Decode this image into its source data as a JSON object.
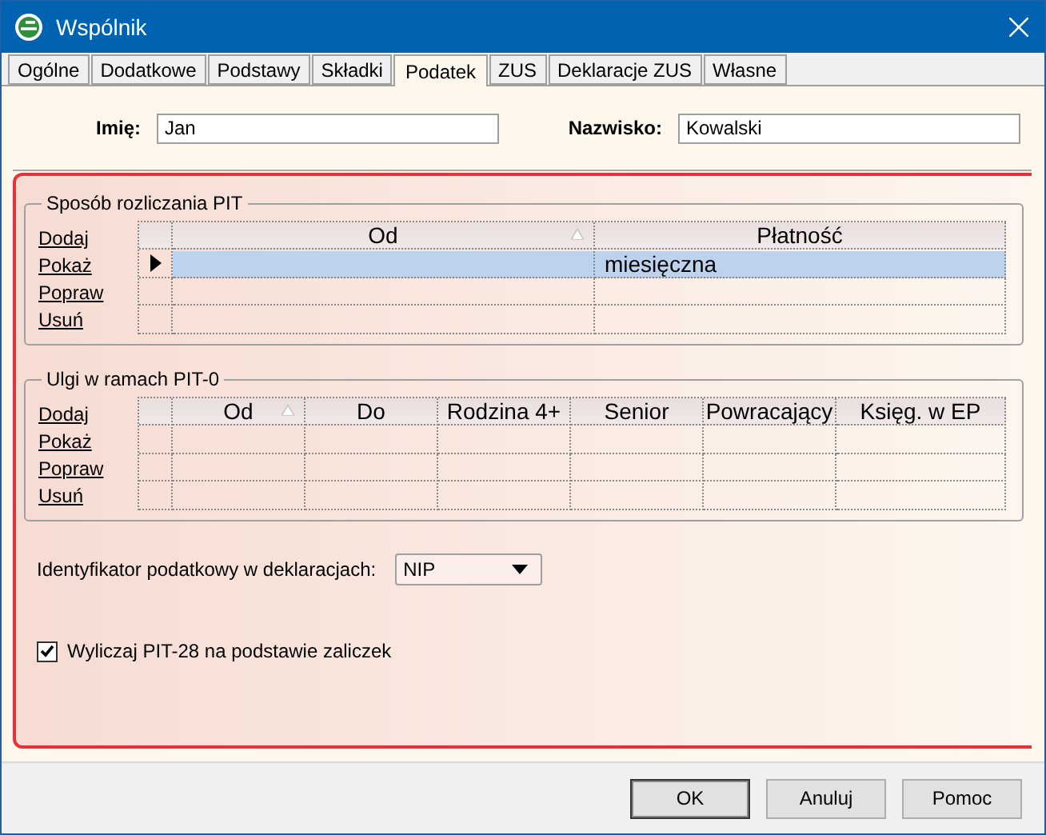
{
  "window": {
    "title": "Wspólnik"
  },
  "tabs": [
    {
      "label": "Ogólne",
      "selected": false
    },
    {
      "label": "Dodatkowe",
      "selected": false
    },
    {
      "label": "Podstawy",
      "selected": false
    },
    {
      "label": "Składki",
      "selected": false
    },
    {
      "label": "Podatek",
      "selected": true
    },
    {
      "label": "ZUS",
      "selected": false
    },
    {
      "label": "Deklaracje ZUS",
      "selected": false
    },
    {
      "label": "Własne",
      "selected": false
    }
  ],
  "person": {
    "first_name_label": "Imię:",
    "first_name": "Jan",
    "last_name_label": "Nazwisko:",
    "last_name": "Kowalski"
  },
  "groups": [
    {
      "title": "Sposób rozliczania PIT",
      "actions": [
        "Dodaj",
        "Pokaż",
        "Popraw",
        "Usuń"
      ],
      "columns": [
        {
          "label": "Od",
          "sorted": true
        },
        {
          "label": "Płatność",
          "sorted": false
        }
      ],
      "rows": [
        {
          "selected": true,
          "cells": [
            null,
            "miesięczna"
          ]
        },
        {
          "selected": false,
          "cells": [
            null,
            null
          ]
        },
        {
          "selected": false,
          "cells": [
            null,
            null
          ]
        }
      ]
    },
    {
      "title": "Ulgi w ramach PIT-0",
      "actions": [
        "Dodaj",
        "Pokaż",
        "Popraw",
        "Usuń"
      ],
      "columns": [
        {
          "label": "Od",
          "sorted": true
        },
        {
          "label": "Do",
          "sorted": false
        },
        {
          "label": "Rodzina 4+",
          "sorted": false
        },
        {
          "label": "Senior",
          "sorted": false
        },
        {
          "label": "Powracający",
          "sorted": false
        },
        {
          "label": "Księg. w EP",
          "sorted": false
        }
      ],
      "rows": [
        {
          "selected": false,
          "cells": [
            null,
            null,
            null,
            null,
            null,
            null
          ]
        },
        {
          "selected": false,
          "cells": [
            null,
            null,
            null,
            null,
            null,
            null
          ]
        },
        {
          "selected": false,
          "cells": [
            null,
            null,
            null,
            null,
            null,
            null
          ]
        }
      ]
    }
  ],
  "tax_id": {
    "label": "Identyfikator podatkowy w deklaracjach:",
    "value": "NIP"
  },
  "calc_checkbox": {
    "label": "Wyliczaj PIT-28 na podstawie zaliczek",
    "checked": true
  },
  "buttons": [
    "OK",
    "Anuluj",
    "Pomoc"
  ]
}
